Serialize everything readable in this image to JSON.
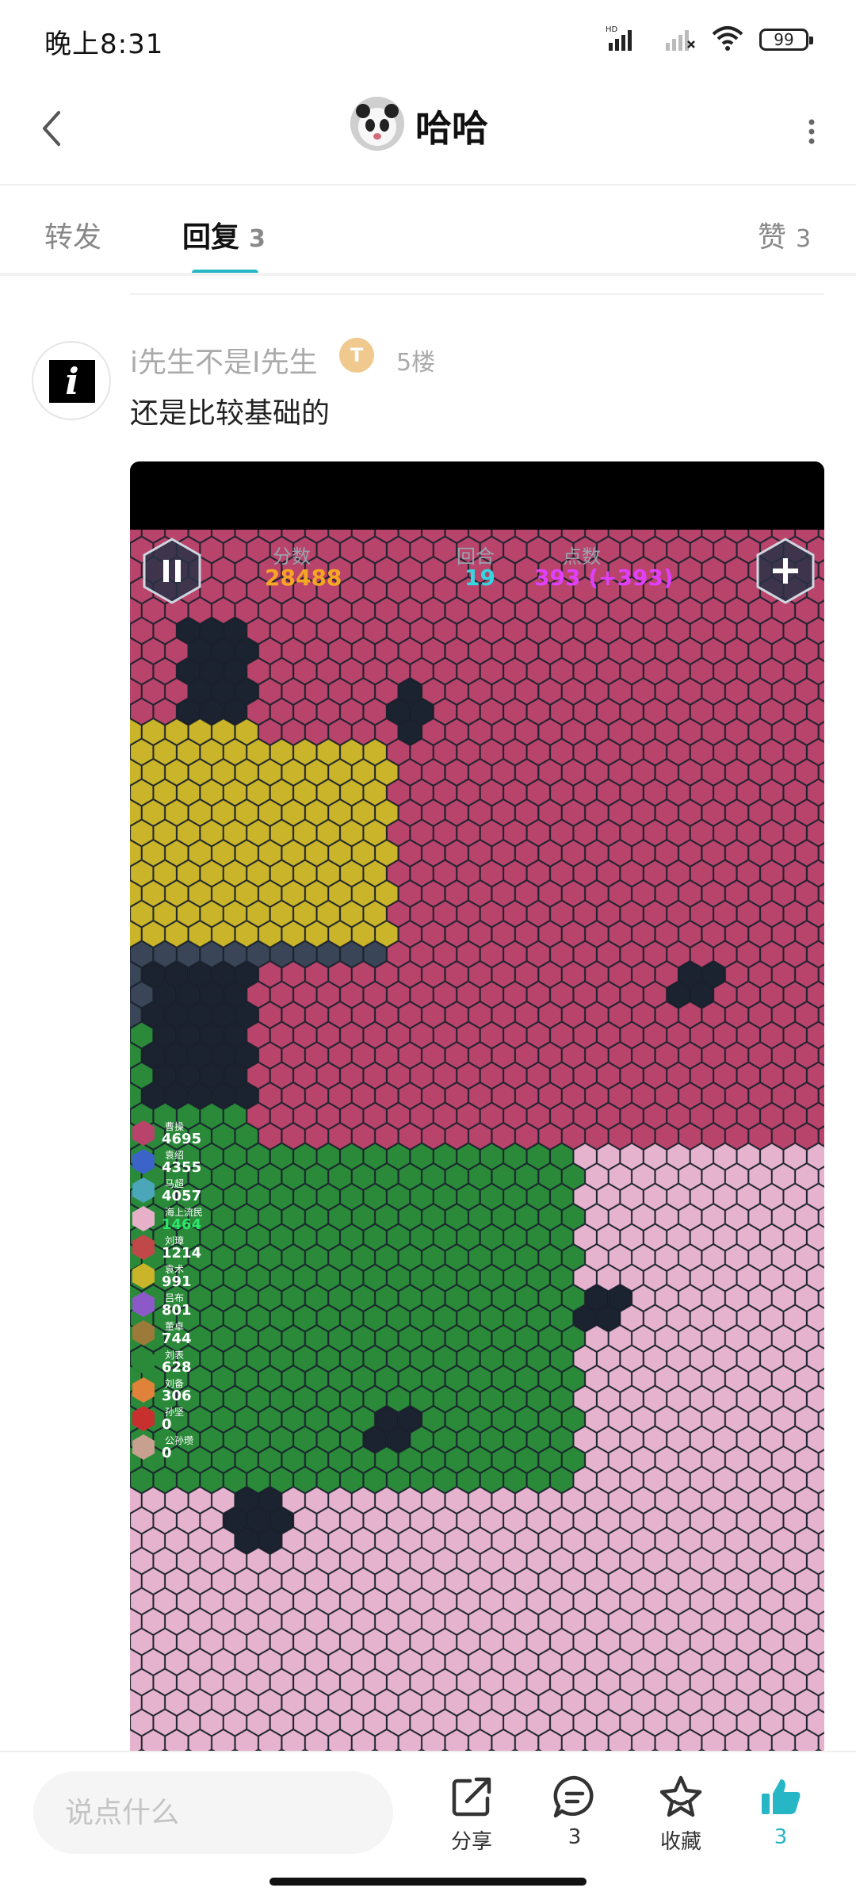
{
  "status_bar": {
    "time": "晚上8:31",
    "network_label": "HD",
    "battery": "99"
  },
  "header": {
    "title": "哈哈"
  },
  "tabs": [
    {
      "label": "转发",
      "count": ""
    },
    {
      "label": "回复",
      "count": "3"
    },
    {
      "label": "赞",
      "count": "3"
    }
  ],
  "reply": {
    "username": "i先生不是I先生",
    "badge_letter": "T",
    "floor": "5楼",
    "text": "还是比较基础的",
    "avatar_glyph": "i"
  },
  "game": {
    "hud": {
      "score_label": "分数",
      "score": "28488",
      "round_label": "回合",
      "round": "19",
      "points_label": "点数",
      "points": "393 (+393)"
    },
    "leaderboard": [
      {
        "name": "曹操",
        "score": "4695",
        "color": "#b8446b"
      },
      {
        "name": "袁绍",
        "score": "4355",
        "color": "#3c64c8"
      },
      {
        "name": "马超",
        "score": "4057",
        "color": "#4aa6b8"
      },
      {
        "name": "海上流民",
        "score": "1464",
        "color": "#e6b0c8"
      },
      {
        "name": "刘璋",
        "score": "1214",
        "color": "#c04848"
      },
      {
        "name": "袁术",
        "score": "991",
        "color": "#c9b42a"
      },
      {
        "name": "吕布",
        "score": "801",
        "color": "#8c5ac8"
      },
      {
        "name": "董卓",
        "score": "744",
        "color": "#9c7a3a"
      },
      {
        "name": "刘表",
        "score": "628",
        "color": "#2a8a3a"
      },
      {
        "name": "刘备",
        "score": "306",
        "color": "#e0823a"
      },
      {
        "name": "孙坚",
        "score": "0",
        "color": "#c83030"
      },
      {
        "name": "公孙瓒",
        "score": "0",
        "color": "#c8a090"
      }
    ],
    "colors": {
      "wei": "#b8446b",
      "yellow": "#c9b42a",
      "brazil": "#2a8a3a",
      "pink": "#e6b3cf",
      "sea": "#3a4658",
      "deep": "#1c2330"
    }
  },
  "bottom_bar": {
    "input_placeholder": "说点什么",
    "share_label": "分享",
    "comment_count": "3",
    "favorite_label": "收藏",
    "like_count": "3"
  },
  "colors": {
    "accent": "#26b6c6"
  }
}
